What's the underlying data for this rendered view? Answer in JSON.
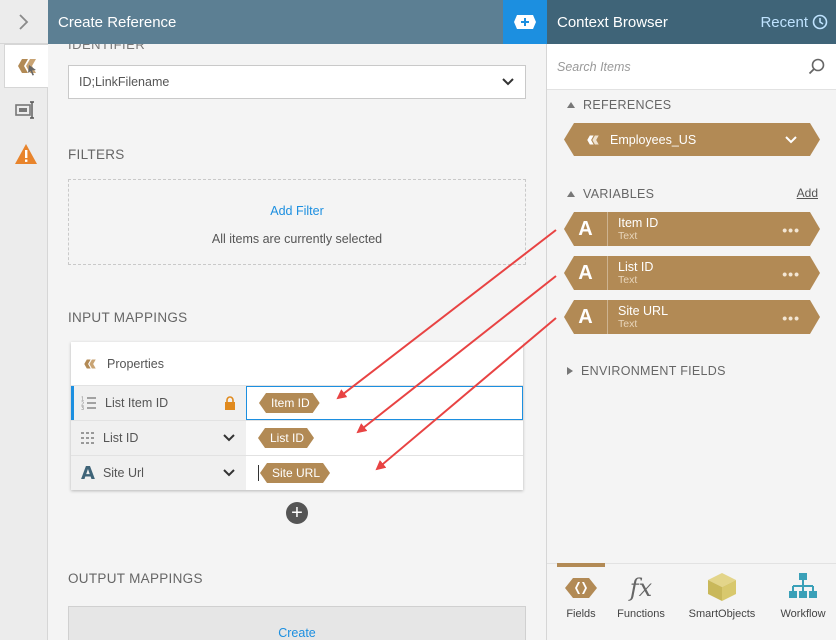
{
  "header": {
    "left_title": "Create Reference",
    "right_title": "Context Browser",
    "recent_label": "Recent"
  },
  "left": {
    "identifier_label": "IDENTIFIER",
    "identifier_value": "ID;LinkFilename",
    "filters_title": "FILTERS",
    "add_filter": "Add Filter",
    "filter_note": "All items are currently selected",
    "input_mappings_title": "INPUT MAPPINGS",
    "properties_label": "Properties",
    "mappings": [
      {
        "field": "List Item ID",
        "value": "Item ID"
      },
      {
        "field": "List ID",
        "value": "List ID"
      },
      {
        "field": "Site Url",
        "value": "Site URL"
      }
    ],
    "output_mappings_title": "OUTPUT MAPPINGS",
    "create_label": "Create"
  },
  "right": {
    "search_placeholder": "Search Items",
    "references_title": "REFERENCES",
    "reference_item": "Employees_US",
    "variables_title": "VARIABLES",
    "variables_add": "Add",
    "variables": [
      {
        "name": "Item ID",
        "type": "Text"
      },
      {
        "name": "List ID",
        "type": "Text"
      },
      {
        "name": "Site URL",
        "type": "Text"
      }
    ],
    "environment_title": "ENVIRONMENT FIELDS",
    "tabs": [
      "Fields",
      "Functions",
      "SmartObjects",
      "Workflow"
    ]
  },
  "colors": {
    "header_left": "#5c7f93",
    "header_right": "#3f6478",
    "accent_blue": "#1c8fe0",
    "pill_brown": "#b28a55",
    "arrow_red": "#e84343"
  },
  "icons": [
    "chevron-right-icon",
    "reference-icon",
    "form-icon",
    "warning-icon",
    "add-icon",
    "clock-icon",
    "search-icon",
    "lock-icon",
    "chevron-down-icon"
  ]
}
